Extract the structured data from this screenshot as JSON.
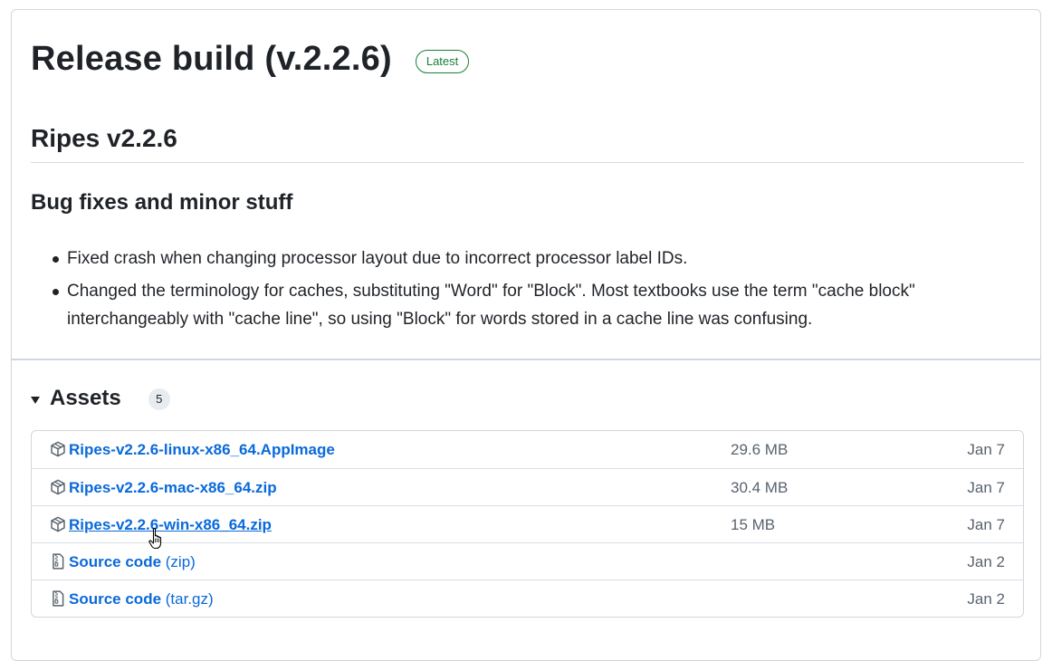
{
  "release": {
    "title": "Release build (v.2.2.6)",
    "badge": "Latest"
  },
  "notes": {
    "version_heading": "Ripes v2.2.6",
    "section_heading": "Bug fixes and minor stuff",
    "items": [
      "Fixed crash when changing processor layout due to incorrect processor label IDs.",
      "Changed the terminology for caches, substituting \"Word\" for \"Block\". Most textbooks use the term \"cache block\" interchangeably with \"cache line\", so using \"Block\" for words stored in a cache line was confusing."
    ]
  },
  "assets": {
    "title": "Assets",
    "count": "5",
    "rows": [
      {
        "name": "Ripes-v2.2.6-linux-x86_64.AppImage",
        "suffix": "",
        "size": "29.6 MB",
        "date": "Jan 7",
        "icon": "package-icon"
      },
      {
        "name": "Ripes-v2.2.6-mac-x86_64.zip",
        "suffix": "",
        "size": "30.4 MB",
        "date": "Jan 7",
        "icon": "package-icon"
      },
      {
        "name": "Ripes-v2.2.6-win-x86_64.zip",
        "suffix": "",
        "size": "15 MB",
        "date": "Jan 7",
        "icon": "package-icon"
      },
      {
        "name": "Source code",
        "suffix": " (zip)",
        "size": "",
        "date": "Jan 2",
        "icon": "file-zip-icon"
      },
      {
        "name": "Source code",
        "suffix": " (tar.gz)",
        "size": "",
        "date": "Jan 2",
        "icon": "file-zip-icon"
      }
    ]
  },
  "colors": {
    "link": "#0969da",
    "badge_green": "#1a7f37",
    "muted": "#59636e",
    "border": "#d0d7de"
  }
}
